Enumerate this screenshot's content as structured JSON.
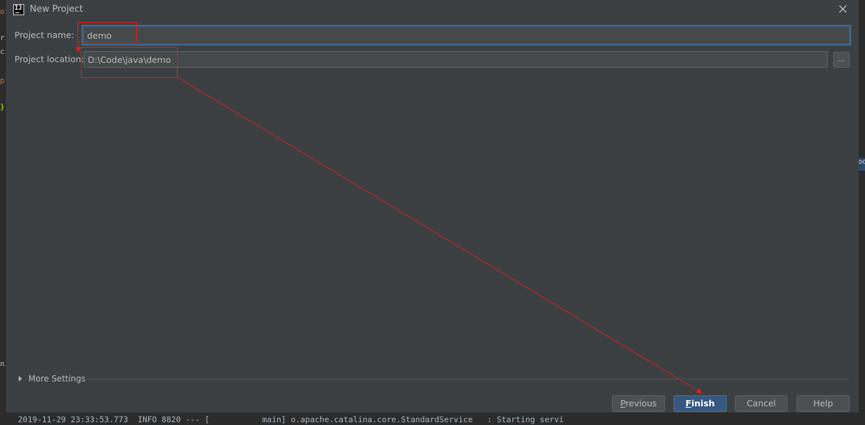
{
  "dialog": {
    "title": "New Project",
    "project_name_label": "Project name:",
    "project_name_value": "demo",
    "project_location_label": "Project location:",
    "project_location_value": "D:\\Code\\java\\demo",
    "browse_label": "...",
    "more_settings_label": "More Settings"
  },
  "buttons": {
    "previous": {
      "label": "Previous",
      "mnemonic": "P",
      "rest": "revious"
    },
    "finish": {
      "label": "Finish",
      "mnemonic": "F",
      "rest": "inish"
    },
    "cancel": {
      "label": "Cancel"
    },
    "help": {
      "label": "Help"
    }
  },
  "icons": {
    "app": "intellij-idea-icon",
    "close": "close-icon",
    "expand": "expand-triangle-icon",
    "browse": "ellipsis-icon"
  },
  "background": {
    "console_line": "2019-11-29 23:33:53.773  INFO 8820 --- [           main] o.apache.catalina.core.StandardService   : Starting servi"
  },
  "colors": {
    "dialog_bg": "#3c3f41",
    "field_bg": "#45494a",
    "focus_border": "#3d6185",
    "primary_button": "#365880",
    "annotation_red": "#e02020"
  }
}
